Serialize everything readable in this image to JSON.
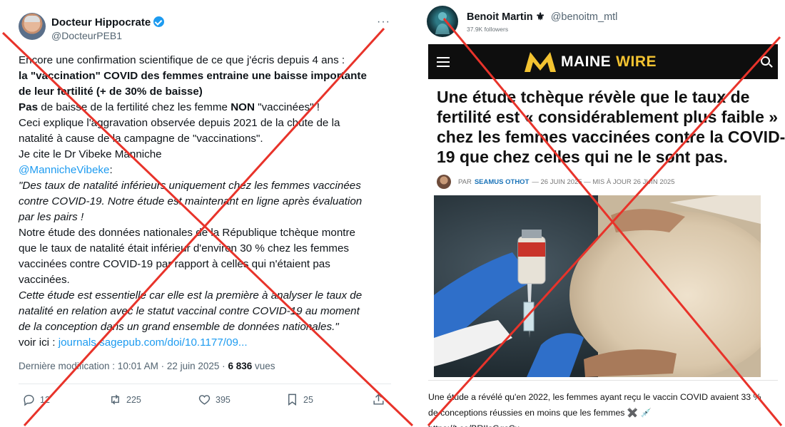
{
  "left_tweet": {
    "display_name": "Docteur Hippocrate",
    "handle": "@DocteurPEB1",
    "more_icon": "ellipsis-icon",
    "lines": [
      "Encore une confirmation scientifique de ce que j'écris depuis 4 ans :",
      "la \"vaccination\" COVID des femmes entraine une baisse importante",
      "de leur fertilité (+ de 30% de baisse)",
      "de baisse de la fertilité chez les femme",
      "\"vaccinées\" !",
      "Ceci explique l'aggravation observée depuis 2021 de la chute de la",
      "natalité à cause de la campagne de \"vaccinations\".",
      "Je cite le Dr Vibeke Manniche",
      "@MannicheVibeke",
      "\"Des taux de natalité inférieurs uniquement chez les femmes vaccinées",
      "contre COVID-19. Notre étude est maintenant en ligne après évaluation",
      "par les pairs !",
      "Notre étude des données nationales de la République tchèque montre",
      "que le taux de natalité était inférieur d'environ 30 % chez les femmes",
      "vaccinées contre COVID-19 par rapport à celles qui n'étaient pas",
      "vaccinées.",
      "Cette étude est essentielle car elle est la première à analyser le taux de",
      "natalité en relation avec le statut vaccinal contre COVID-19 au moment",
      "de la conception dans un grand ensemble de données nationales.\"",
      "voir ici :",
      "journals.sagepub.com/doi/10.1177/09..."
    ],
    "bold_pas": "Pas",
    "bold_non": "NON",
    "colon": ":",
    "meta_prefix": "Dernière modification : 10:01 AM · 22 juin 2025 ·",
    "views_count": "6 836",
    "views_label": "vues",
    "actions": {
      "reply": "12",
      "retweet": "225",
      "like": "395",
      "bookmark": "25"
    }
  },
  "right_post": {
    "display_name": "Benoit Martin",
    "handle": "@benoitm_mtl",
    "followers": "37.9K followers",
    "site_name_main": "MAINE",
    "site_name_accent": "WIRE",
    "headline_lines": [
      "Une étude tchèque révèle que le taux de",
      "fertilité est « considérablement plus faible »",
      "chez les femmes vaccinées contre la COVID-",
      "19 que chez celles qui ne le sont pas."
    ],
    "byline_prefix": "PAR",
    "byline_author": "SEAMUS OTHOT",
    "byline_dates": "— 26 JUIN 2025 — MIS À JOUR 26 JUIN 2025",
    "caption_line1": "Une étude a révélé qu'en 2022, les femmes ayant reçu le vaccin COVID avaient 33 %",
    "caption_line2_prefix": "de conceptions réussies en moins que les femmes ✖️ 💉",
    "caption_url": "https://t.co/BRIIsGgsCx"
  },
  "colors": {
    "x_red": "#e8332a",
    "link_blue": "#1d9bf0",
    "accent_yellow": "#f3c331"
  }
}
